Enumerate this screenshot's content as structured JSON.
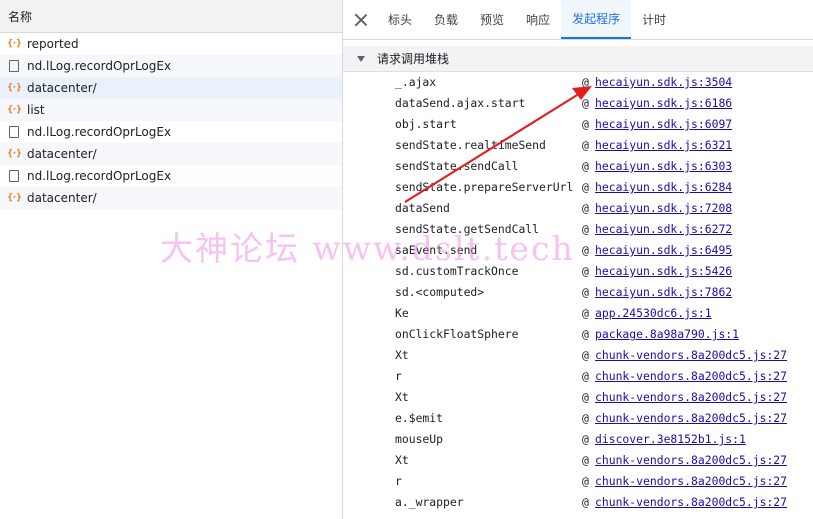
{
  "left_panel": {
    "header": "名称",
    "requests": [
      {
        "name": "reported",
        "type": "xhr"
      },
      {
        "name": "nd.lLog.recordOprLogEx",
        "type": "doc"
      },
      {
        "name": "datacenter/",
        "type": "xhr"
      },
      {
        "name": "list",
        "type": "xhr"
      },
      {
        "name": "nd.lLog.recordOprLogEx",
        "type": "doc"
      },
      {
        "name": "datacenter/",
        "type": "xhr"
      },
      {
        "name": "nd.lLog.recordOprLogEx",
        "type": "doc"
      },
      {
        "name": "datacenter/",
        "type": "xhr"
      }
    ],
    "selected_index": 2
  },
  "tabs": [
    "标头",
    "负载",
    "预览",
    "响应",
    "发起程序",
    "计时"
  ],
  "active_tab": "发起程序",
  "section_title": "请求调用堆栈",
  "call_stack": [
    {
      "fn": "_.ajax",
      "loc": "hecaiyun.sdk.js:3504"
    },
    {
      "fn": "dataSend.ajax.start",
      "loc": "hecaiyun.sdk.js:6186"
    },
    {
      "fn": "obj.start",
      "loc": "hecaiyun.sdk.js:6097"
    },
    {
      "fn": "sendState.realtimeSend",
      "loc": "hecaiyun.sdk.js:6321"
    },
    {
      "fn": "sendState.sendCall",
      "loc": "hecaiyun.sdk.js:6303"
    },
    {
      "fn": "sendState.prepareServerUrl",
      "loc": "hecaiyun.sdk.js:6284"
    },
    {
      "fn": "dataSend",
      "loc": "hecaiyun.sdk.js:7208"
    },
    {
      "fn": "sendState.getSendCall",
      "loc": "hecaiyun.sdk.js:6272"
    },
    {
      "fn": "saEvent.send",
      "loc": "hecaiyun.sdk.js:6495"
    },
    {
      "fn": "sd.customTrackOnce",
      "loc": "hecaiyun.sdk.js:5426"
    },
    {
      "fn": "sd.<computed>",
      "loc": "hecaiyun.sdk.js:7862"
    },
    {
      "fn": "Ke",
      "loc": "app.24530dc6.js:1"
    },
    {
      "fn": "onClickFloatSphere",
      "loc": "package.8a98a790.js:1"
    },
    {
      "fn": "Xt",
      "loc": "chunk-vendors.8a200dc5.js:27"
    },
    {
      "fn": "r",
      "loc": "chunk-vendors.8a200dc5.js:27"
    },
    {
      "fn": "Xt",
      "loc": "chunk-vendors.8a200dc5.js:27"
    },
    {
      "fn": "e.$emit",
      "loc": "chunk-vendors.8a200dc5.js:27"
    },
    {
      "fn": "mouseUp",
      "loc": "discover.3e8152b1.js:1"
    },
    {
      "fn": "Xt",
      "loc": "chunk-vendors.8a200dc5.js:27"
    },
    {
      "fn": "r",
      "loc": "chunk-vendors.8a200dc5.js:27"
    },
    {
      "fn": "a._wrapper",
      "loc": "chunk-vendors.8a200dc5.js:27"
    }
  ],
  "at_symbol": "@",
  "watermark": "大神论坛  www.dslt.tech",
  "icons": {
    "xhr": "xhr-braces-icon",
    "doc": "document-icon",
    "close": "close-icon",
    "expand": "triangle-down-icon"
  },
  "colors": {
    "link": "#1a0dab",
    "active_tab": "#1a73e8",
    "xhr_icon": "#e8710a",
    "annotation_arrow": "#e02020",
    "watermark": "#ec78e1"
  }
}
